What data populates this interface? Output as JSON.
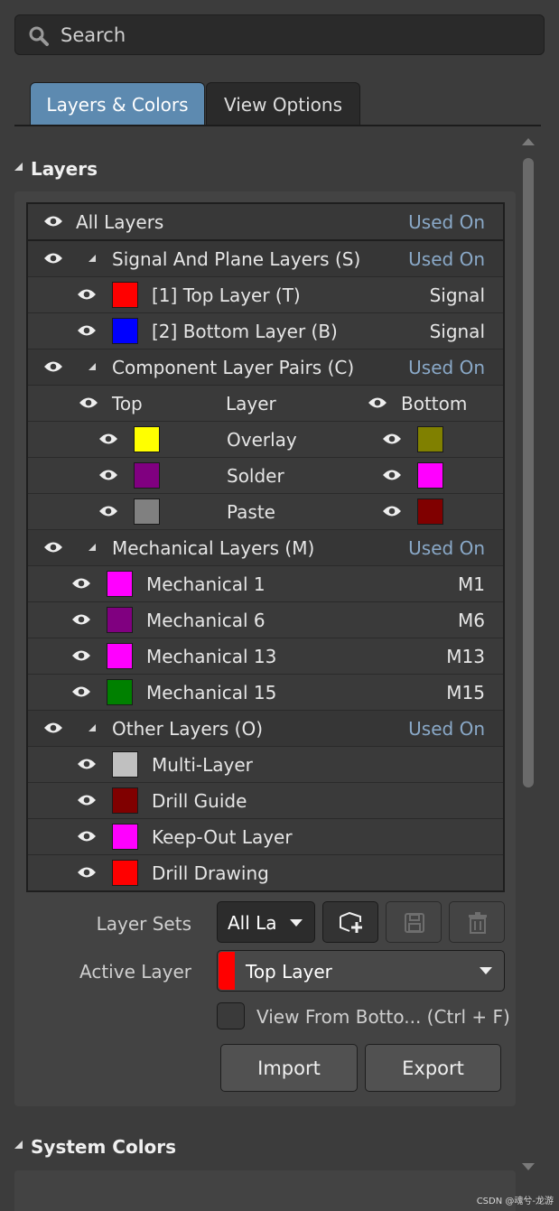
{
  "search": {
    "placeholder": "Search"
  },
  "tabs": [
    {
      "label": "Layers & Colors",
      "active": true
    },
    {
      "label": "View Options",
      "active": false
    }
  ],
  "sections": {
    "layers": "Layers",
    "system_colors": "System Colors"
  },
  "all_layers": {
    "label": "All Layers",
    "right": "Used On"
  },
  "signal": {
    "label": "Signal And Plane Layers (S)",
    "right": "Used On",
    "items": [
      {
        "label": "[1] Top Layer (T)",
        "color": "#ff0000",
        "right": "Signal"
      },
      {
        "label": "[2] Bottom Layer (B)",
        "color": "#0000ff",
        "right": "Signal"
      }
    ]
  },
  "component": {
    "label": "Component Layer Pairs (C)",
    "right": "Used On",
    "header": {
      "top": "Top",
      "layer": "Layer",
      "bottom": "Bottom"
    },
    "pairs": [
      {
        "label": "Overlay",
        "top_color": "#ffff00",
        "bottom_color": "#808000"
      },
      {
        "label": "Solder",
        "top_color": "#800080",
        "bottom_color": "#ff00ff"
      },
      {
        "label": "Paste",
        "top_color": "#808080",
        "bottom_color": "#800000"
      }
    ]
  },
  "mechanical": {
    "label": "Mechanical Layers (M)",
    "right": "Used On",
    "items": [
      {
        "label": "Mechanical 1",
        "color": "#ff00ff",
        "right": "M1"
      },
      {
        "label": "Mechanical 6",
        "color": "#800080",
        "right": "M6"
      },
      {
        "label": "Mechanical 13",
        "color": "#ff00ff",
        "right": "M13"
      },
      {
        "label": "Mechanical 15",
        "color": "#008000",
        "right": "M15"
      }
    ]
  },
  "other": {
    "label": "Other Layers (O)",
    "right": "Used On",
    "items": [
      {
        "label": "Multi-Layer",
        "color": "#c0c0c0"
      },
      {
        "label": "Drill Guide",
        "color": "#800000"
      },
      {
        "label": "Keep-Out Layer",
        "color": "#ff00ff"
      },
      {
        "label": "Drill Drawing",
        "color": "#ff0000"
      }
    ]
  },
  "controls": {
    "layer_sets_label": "Layer Sets",
    "layer_sets_value": "All La",
    "active_layer_label": "Active Layer",
    "active_layer_value": "Top Layer",
    "active_layer_color": "#ff0000",
    "view_from_bottom": "View From Botto... (Ctrl + F)",
    "import": "Import",
    "export": "Export"
  },
  "watermark": "CSDN @魂兮-龙游"
}
